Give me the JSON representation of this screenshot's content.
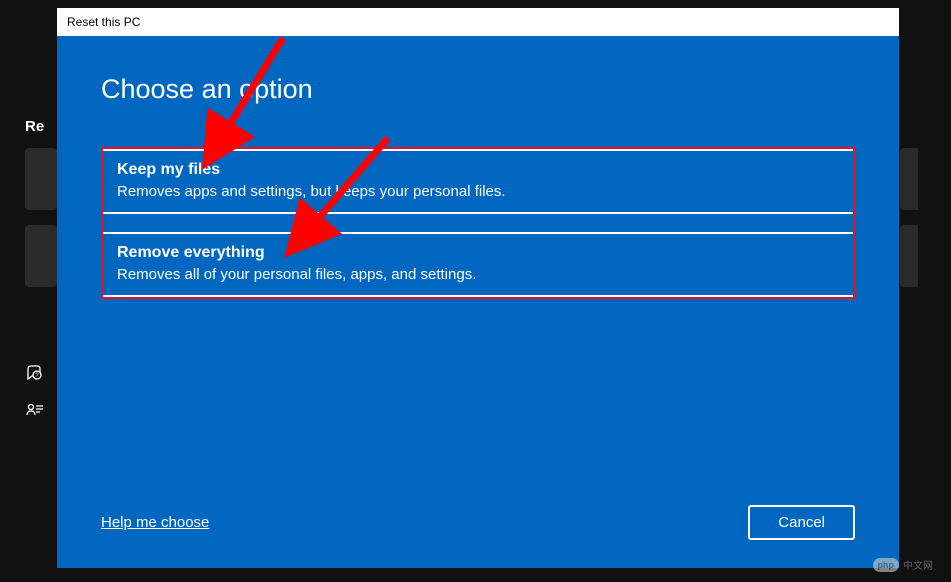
{
  "background": {
    "sectionLabel": "Re"
  },
  "dialog": {
    "title": "Reset this PC",
    "heading": "Choose an option",
    "options": [
      {
        "title": "Keep my files",
        "description": "Removes apps and settings, but keeps your personal files."
      },
      {
        "title": "Remove everything",
        "description": "Removes all of your personal files, apps, and settings."
      }
    ],
    "helpLink": "Help me choose",
    "cancelButton": "Cancel"
  },
  "watermark": {
    "badge": "php",
    "text": "中文网"
  }
}
